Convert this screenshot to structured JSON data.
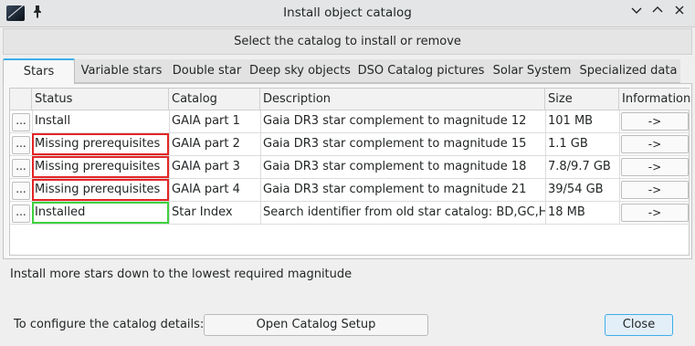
{
  "window": {
    "title": "Install object catalog",
    "icons": {
      "app": "catalog-app-icon",
      "pin": "pin-icon",
      "minimize": "chevron-down-icon",
      "maximize": "chevron-up-icon",
      "close": "close-icon"
    }
  },
  "header": {
    "text": "Select the catalog to install or remove"
  },
  "tabs": [
    {
      "label": "Stars",
      "active": true
    },
    {
      "label": "Variable stars",
      "active": false
    },
    {
      "label": "Double star",
      "active": false
    },
    {
      "label": "Deep sky objects",
      "active": false
    },
    {
      "label": "DSO Catalog pictures",
      "active": false
    },
    {
      "label": "Solar System",
      "active": false
    },
    {
      "label": "Specialized data",
      "active": false
    }
  ],
  "table": {
    "columns": [
      "Status",
      "Catalog",
      "Description",
      "Size",
      "Information"
    ],
    "rows": [
      {
        "action": "...",
        "status": "Install",
        "catalog": "GAIA part 1",
        "description": "Gaia DR3 star complement to magnitude 12",
        "size": "101 MB",
        "info": "->",
        "highlight": "none"
      },
      {
        "action": "...",
        "status": "Missing prerequisites",
        "catalog": "GAIA part 2",
        "description": "Gaia DR3 star complement to magnitude 15",
        "size": "1.1 GB",
        "info": "->",
        "highlight": "red"
      },
      {
        "action": "...",
        "status": "Missing prerequisites",
        "catalog": "GAIA part 3",
        "description": "Gaia DR3 star complement to magnitude 18",
        "size": "7.8/9.7 GB",
        "info": "->",
        "highlight": "red"
      },
      {
        "action": "...",
        "status": "Missing prerequisites",
        "catalog": "GAIA part 4",
        "description": "Gaia DR3 star complement to magnitude 21",
        "size": "39/54 GB",
        "info": "->",
        "highlight": "red"
      },
      {
        "action": "...",
        "status": "Installed",
        "catalog": "Star Index",
        "description": "Search identifier from old star catalog: BD,GC,HD,S",
        "size": "18 MB",
        "info": "->",
        "highlight": "green"
      }
    ]
  },
  "hint": "Install more stars down to the lowest required magnitude",
  "footer": {
    "config_label": "To configure the catalog details:",
    "setup_button": "Open Catalog Setup",
    "close_button": "Close"
  },
  "colors": {
    "accent": "#3daee9",
    "missing": "#e32525",
    "installed": "#3fd13f"
  }
}
